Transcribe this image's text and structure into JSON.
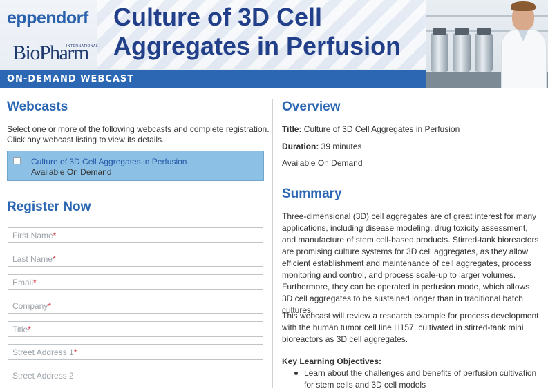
{
  "banner": {
    "brand_eppendorf": "eppendorf",
    "brand_biopharm": "BioPharm",
    "brand_biopharm_sub": "INTERNATIONAL",
    "title": "Culture of 3D Cell Aggregates in Perfusion",
    "label": "ON-DEMAND WEBCAST"
  },
  "webcasts": {
    "heading": "Webcasts",
    "intro": "Select one or more of the following webcasts and complete registration. Click any webcast listing to view its details.",
    "items": [
      {
        "title": "Culture of 3D Cell Aggregates in Perfusion",
        "status": "Available On Demand",
        "checked": false
      }
    ]
  },
  "register": {
    "heading": "Register Now",
    "fields": [
      {
        "placeholder": "First Name",
        "required_mark": "*"
      },
      {
        "placeholder": "Last Name",
        "required_mark": "*"
      },
      {
        "placeholder": "Email",
        "required_mark": "*"
      },
      {
        "placeholder": "Company",
        "required_mark": "*"
      },
      {
        "placeholder": "Title",
        "required_mark": "*"
      },
      {
        "placeholder": "Street Address 1",
        "required_mark": "*"
      },
      {
        "placeholder": "Street Address 2",
        "required_mark": ""
      }
    ]
  },
  "overview": {
    "heading": "Overview",
    "title_label": "Title:",
    "title_value": " Culture of 3D Cell Aggregates in Perfusion",
    "duration_label": "Duration:",
    "duration_value": " 39 minutes",
    "availability": "Available On Demand"
  },
  "summary": {
    "heading": "Summary",
    "paragraph1": "Three-dimensional (3D) cell aggregates are of great interest for many applications, including disease modeling, drug toxicity assessment, and manufacture of stem cell-based products. Stirred-tank bioreactors are promising culture systems for 3D cell aggregates, as they allow efficient establishment and maintenance of cell aggregates, process monitoring and control, and process scale-up to larger volumes. Furthermore, they can be operated in perfusion mode, which allows 3D cell aggregates to be sustained longer than in traditional batch cultures.",
    "paragraph2": "This webcast will review a research example for process development with the human tumor cell line H157, cultivated in stirred-tank mini bioreactors as 3D cell aggregates.",
    "objectives_heading": "Key Learning Objectives:",
    "objectives": [
      "Learn about the challenges and benefits of perfusion cultivation for stem cells and 3D cell models"
    ]
  },
  "colors": {
    "accent_blue": "#2b67b3",
    "title_navy": "#223f8a",
    "selected_row": "#8cc0e4",
    "required_red": "#d9333f"
  },
  "icons": [
    "checkbox-icon",
    "bullet-icon"
  ]
}
